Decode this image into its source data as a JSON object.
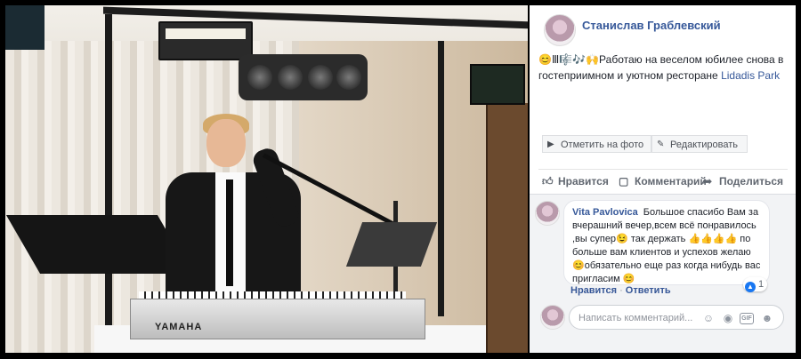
{
  "post": {
    "author": "Станислав Граблевский",
    "text_emoji": "😊Ⅲ🎼🎶🙌",
    "text": "Работаю на веселом юбилее снова в гостеприимном и уютном ресторане ",
    "place_link": "Lidadis Park"
  },
  "photo": {
    "keyboard_brand": "YAMAHA"
  },
  "tag_actions": {
    "tag_label": "Отметить на фото",
    "edit_label": "Редактировать"
  },
  "actions": {
    "like": "Нравится",
    "comment": "Комментарий",
    "share": "Поделиться"
  },
  "comment": {
    "author": "Vita Pavlovica",
    "text_1": "Большое   спасибо Вам за вчерашний вечер,всем  всё понравилось ,вы супер",
    "emoji_1": "😉",
    "text_2": " так  держать",
    "emoji_2": "👍👍👍👍",
    "text_3": " по больше вам клиентов и успехов желаю ",
    "emoji_3": "😊",
    "text_4": "обязательно еще раз когда нибудь вас пригласим ",
    "emoji_4": "😊",
    "like_action": "Нравится",
    "reply_action": "Ответить",
    "reaction_count": "1"
  },
  "compose": {
    "placeholder": "Написать комментарий...",
    "gif_label": "GIF"
  },
  "icons": {
    "tag": "tag-icon",
    "edit": "pencil-icon",
    "like": "thumbs-up-icon",
    "comment": "comment-icon",
    "share": "share-icon",
    "emoji": "smiley-icon",
    "camera": "camera-icon",
    "gif": "gif-icon",
    "sticker": "sticker-icon"
  },
  "colors": {
    "link": "#365899",
    "like_badge": "#1877f2"
  }
}
